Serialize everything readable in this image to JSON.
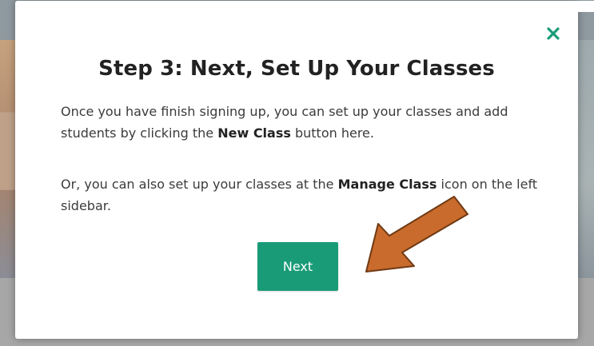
{
  "modal": {
    "title": "Step 3: Next, Set Up Your Classes",
    "paragraph1": {
      "text_before": "Once you have finish signing up, you can set up your classes and add students by clicking the ",
      "bold": "New Class",
      "text_after": " button here."
    },
    "paragraph2": {
      "text_before": "Or, you can also set up your classes at the ",
      "bold": "Manage Class",
      "text_after": " icon on the left sidebar."
    },
    "next_label": "Next",
    "close_icon": "close-x-icon"
  },
  "colors": {
    "accent_green": "#1a9b78",
    "close_green": "#1a9b78",
    "annotation_arrow": "#c96b2c",
    "annotation_arrow_stroke": "#6f3a14"
  },
  "annotation": {
    "icon": "pointer-arrow-icon"
  }
}
